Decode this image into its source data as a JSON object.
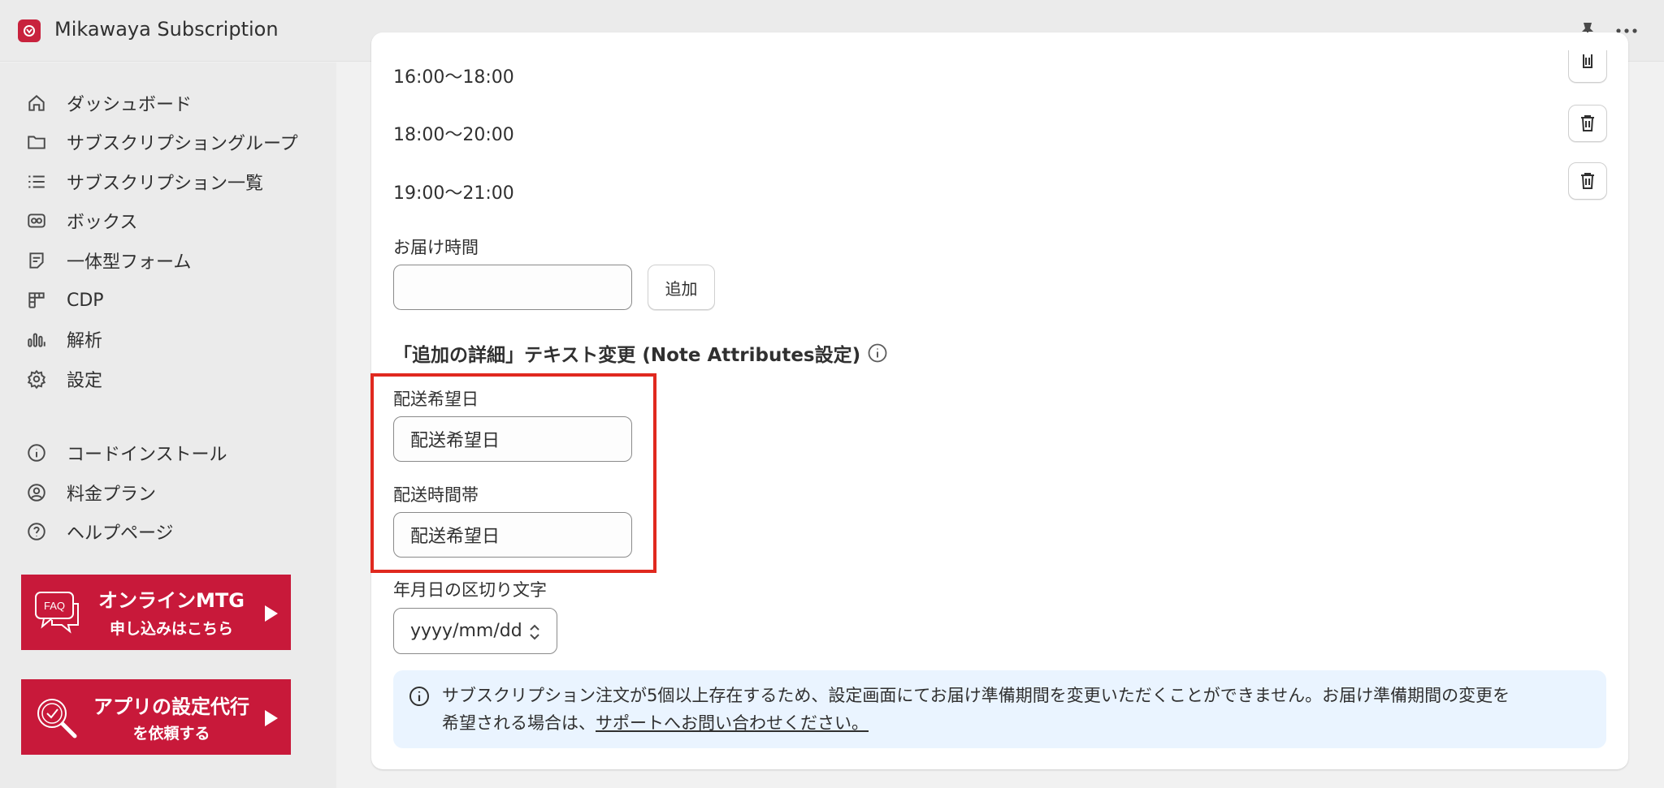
{
  "app": {
    "title": "Mikawaya Subscription"
  },
  "topbar": {
    "pin_icon": "pin-icon",
    "more_icon": "more-icon"
  },
  "sidebar": {
    "items": [
      {
        "label": "ダッシュボード",
        "icon": "home-icon"
      },
      {
        "label": "サブスクリプショングループ",
        "icon": "folder-icon"
      },
      {
        "label": "サブスクリプション一覧",
        "icon": "list-icon"
      },
      {
        "label": "ボックス",
        "icon": "box-icon"
      },
      {
        "label": "一体型フォーム",
        "icon": "form-icon"
      },
      {
        "label": "CDP",
        "icon": "grid-icon"
      },
      {
        "label": "解析",
        "icon": "bar-chart-icon"
      },
      {
        "label": "設定",
        "icon": "gear-icon"
      }
    ],
    "secondary_items": [
      {
        "label": "コードインストール",
        "icon": "info-icon"
      },
      {
        "label": "料金プラン",
        "icon": "user-circle-icon"
      },
      {
        "label": "ヘルプページ",
        "icon": "help-icon"
      }
    ],
    "banners": [
      {
        "line1": "オンラインMTG",
        "line2": "申し込みはこちら",
        "icon_text": "FAQ"
      },
      {
        "line1": "アプリの設定代行",
        "line2": "を依頼する"
      }
    ]
  },
  "main": {
    "time_slots": [
      "16:00〜18:00",
      "18:00〜20:00",
      "19:00〜21:00"
    ],
    "delivery_time": {
      "label": "お届け時間",
      "value": "",
      "placeholder": "",
      "add_label": "追加"
    },
    "note_section": {
      "heading": "「追加の詳細」テキスト変更 (Note Attributes設定)",
      "fields": [
        {
          "label": "配送希望日",
          "value": "配送希望日"
        },
        {
          "label": "配送時間帯",
          "value": "配送希望日"
        }
      ]
    },
    "date_separator": {
      "label": "年月日の区切り文字",
      "selected": "yyyy/mm/dd"
    },
    "notice": {
      "text_line1": "サブスクリプション注文が5個以上存在するため、設定画面にてお届け準備期間を変更いただくことができません。お届け準備期間の変更を",
      "text_line2": "希望される場合は、",
      "link": "サポートへお問い合わせください。"
    }
  },
  "colors": {
    "brand": "#c8193a",
    "highlight": "#e0291f",
    "notice_bg": "#eaf4ff"
  }
}
